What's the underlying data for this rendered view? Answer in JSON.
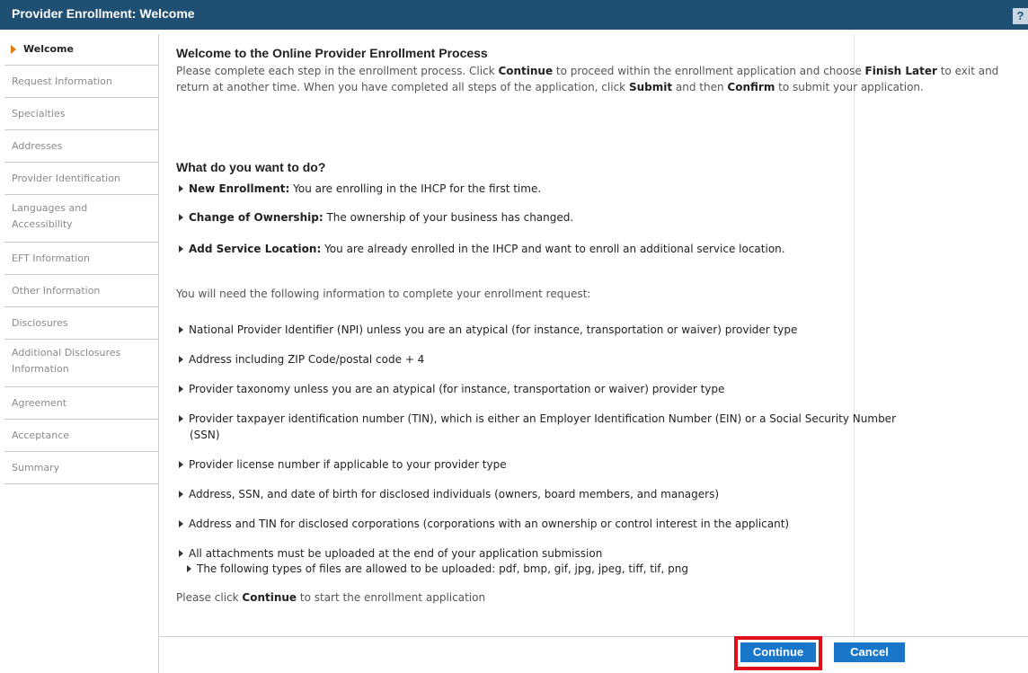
{
  "header": {
    "title": "Provider Enrollment: Welcome",
    "help_icon": "help-icon",
    "help_label": "?"
  },
  "sidebar": {
    "items": [
      {
        "label": "Welcome"
      },
      {
        "label": "Request Information"
      },
      {
        "label": "Specialties"
      },
      {
        "label": "Addresses"
      },
      {
        "label": "Provider Identification"
      },
      {
        "label": "Languages and",
        "label2": "Accessibility"
      },
      {
        "label": "EFT Information"
      },
      {
        "label": "Other Information"
      },
      {
        "label": "Disclosures"
      },
      {
        "label": "Additional Disclosures",
        "label2": "Information"
      },
      {
        "label": "Agreement"
      },
      {
        "label": "Acceptance"
      },
      {
        "label": "Summary"
      }
    ]
  },
  "main": {
    "welcome_heading": "Welcome to the Online Provider Enrollment Process",
    "intro": {
      "p1": "Please complete each step in the enrollment process. Click ",
      "continue": "Continue",
      "p2": " to proceed within the enrollment application and choose ",
      "finish_later": "Finish Later",
      "p3": " to exit and return at another time. When you have completed all steps of the application, click ",
      "submit": "Submit",
      "p4": " and then ",
      "confirm": "Confirm",
      "p5": " to submit your application."
    },
    "what_heading": "What do you want to do?",
    "options": [
      {
        "title": "New Enrollment:",
        "text": " You are enrolling in the IHCP for the first time."
      },
      {
        "title": "Change of Ownership:",
        "text": " The ownership of your business has changed."
      },
      {
        "title": "Add Service Location:",
        "text": " You are already enrolled in the IHCP and want to enroll an additional service location."
      }
    ],
    "need_info": "You will need the following information to complete your enrollment request:",
    "requirements": [
      "National Provider Identifier (NPI) unless you are an atypical (for instance, transportation or waiver) provider type",
      "Address including ZIP Code/postal code + 4",
      "Provider taxonomy unless you are an atypical (for instance, transportation or waiver) provider type",
      "Provider taxpayer identification number (TIN), which is either an Employer Identification Number (EIN) or a Social Security Number",
      "(SSN)",
      "Provider license number if applicable to your provider type",
      "Address, SSN, and date of birth for disclosed individuals (owners, board members, and managers)",
      "Address and TIN for disclosed corporations (corporations with an ownership or control interest in the applicant)",
      "All attachments must be uploaded at the end of your application submission",
      "The following types of files are allowed to be uploaded: pdf, bmp, gif, jpg, jpeg, tiff, tif, png"
    ],
    "closing_pre": "Please click ",
    "closing_bold": "Continue",
    "closing_post": " to start the enrollment application"
  },
  "buttons": {
    "continue": "Continue",
    "cancel": "Cancel"
  }
}
